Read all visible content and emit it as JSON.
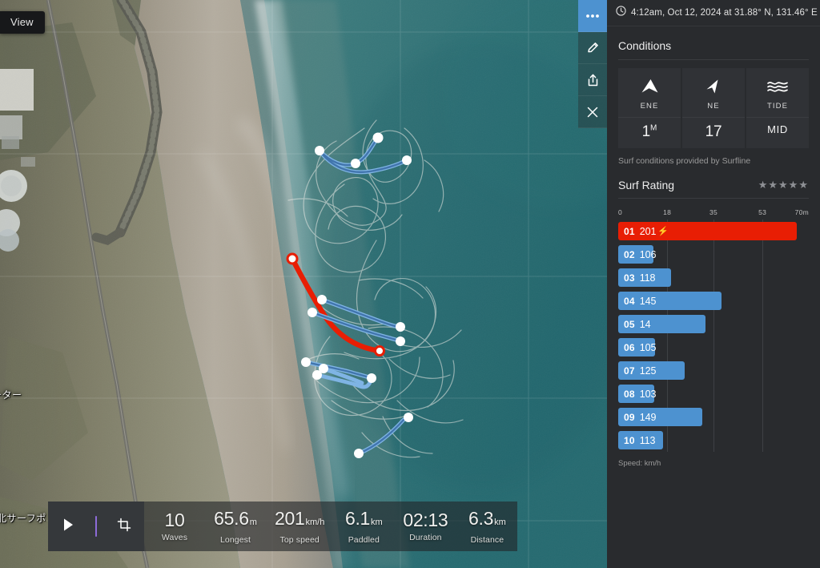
{
  "map": {
    "view_button_label": "View",
    "labels": [
      {
        "text": "ーター"
      },
      {
        "text": "北サーフポ"
      }
    ],
    "toolbar": [
      {
        "name": "more-options",
        "icon": "ellipsis-icon",
        "active": true
      },
      {
        "name": "edit",
        "icon": "pencil-icon",
        "active": false
      },
      {
        "name": "share",
        "icon": "share-icon",
        "active": false
      },
      {
        "name": "close",
        "icon": "close-icon",
        "active": false
      }
    ]
  },
  "hud": {
    "play_label": "play-icon",
    "trim_label": "crop-icon",
    "stats": [
      {
        "value": "10",
        "unit": "",
        "label": "Waves"
      },
      {
        "value": "65.6",
        "unit": "m",
        "label": "Longest"
      },
      {
        "value": "201",
        "unit": "km/h",
        "label": "Top speed"
      },
      {
        "value": "6.1",
        "unit": "km",
        "label": "Paddled"
      },
      {
        "value": "02:13",
        "unit": "",
        "label": "Duration"
      },
      {
        "value": "6.3",
        "unit": "km",
        "label": "Distance"
      }
    ]
  },
  "panel": {
    "header": {
      "icon": "clock-icon",
      "text": "4:12am, Oct 12, 2024 at 31.88° N, 131.46° E"
    },
    "conditions": {
      "title": "Conditions",
      "tiles": [
        {
          "icon": "swell-arrow-icon",
          "direction": "ENE",
          "value": "1",
          "sup": "M"
        },
        {
          "icon": "wind-arrow-icon",
          "direction": "NE",
          "value": "17",
          "sup": ""
        },
        {
          "icon": "tide-waves-icon",
          "direction": "TIDE",
          "value": "MID",
          "sup": ""
        }
      ],
      "credit": "Surf conditions provided by Surfline"
    },
    "rating": {
      "title": "Surf Rating",
      "stars": "★★★★★",
      "count": 5
    },
    "chart_footer": "Speed: km/h"
  },
  "chart_data": {
    "type": "bar",
    "title": "",
    "orientation": "horizontal",
    "xlabel": "m",
    "ylabel": "",
    "xlim": [
      0,
      70
    ],
    "ticks": [
      {
        "value": 0,
        "label": "0"
      },
      {
        "value": 18,
        "label": "18"
      },
      {
        "value": 35,
        "label": "35"
      },
      {
        "value": 53,
        "label": "53"
      },
      {
        "value": 70,
        "label": "70m"
      }
    ],
    "grid": true,
    "legend": "Speed: km/h",
    "unit_bars": "m",
    "unit_labels": "km/h",
    "categories": [
      "01",
      "02",
      "03",
      "04",
      "05",
      "06",
      "07",
      "08",
      "09",
      "10"
    ],
    "values": [
      65.6,
      13.0,
      19.5,
      38.0,
      32.0,
      13.5,
      24.5,
      13.2,
      31.0,
      16.5
    ],
    "speed_labels": [
      "20.1",
      "10.6",
      "11.8",
      "14.5",
      "14",
      "10.5",
      "12.5",
      "10.3",
      "14.9",
      "11.3"
    ],
    "speed_display": [
      "201",
      "106",
      "118",
      "145",
      "14",
      "105",
      "125",
      "103",
      "149",
      "113"
    ],
    "highlight_index": 0,
    "highlight_marker": "⚡",
    "colors": {
      "bar": "#4d92d0",
      "highlight": "#e81e04",
      "grid": "#3e4145"
    }
  }
}
